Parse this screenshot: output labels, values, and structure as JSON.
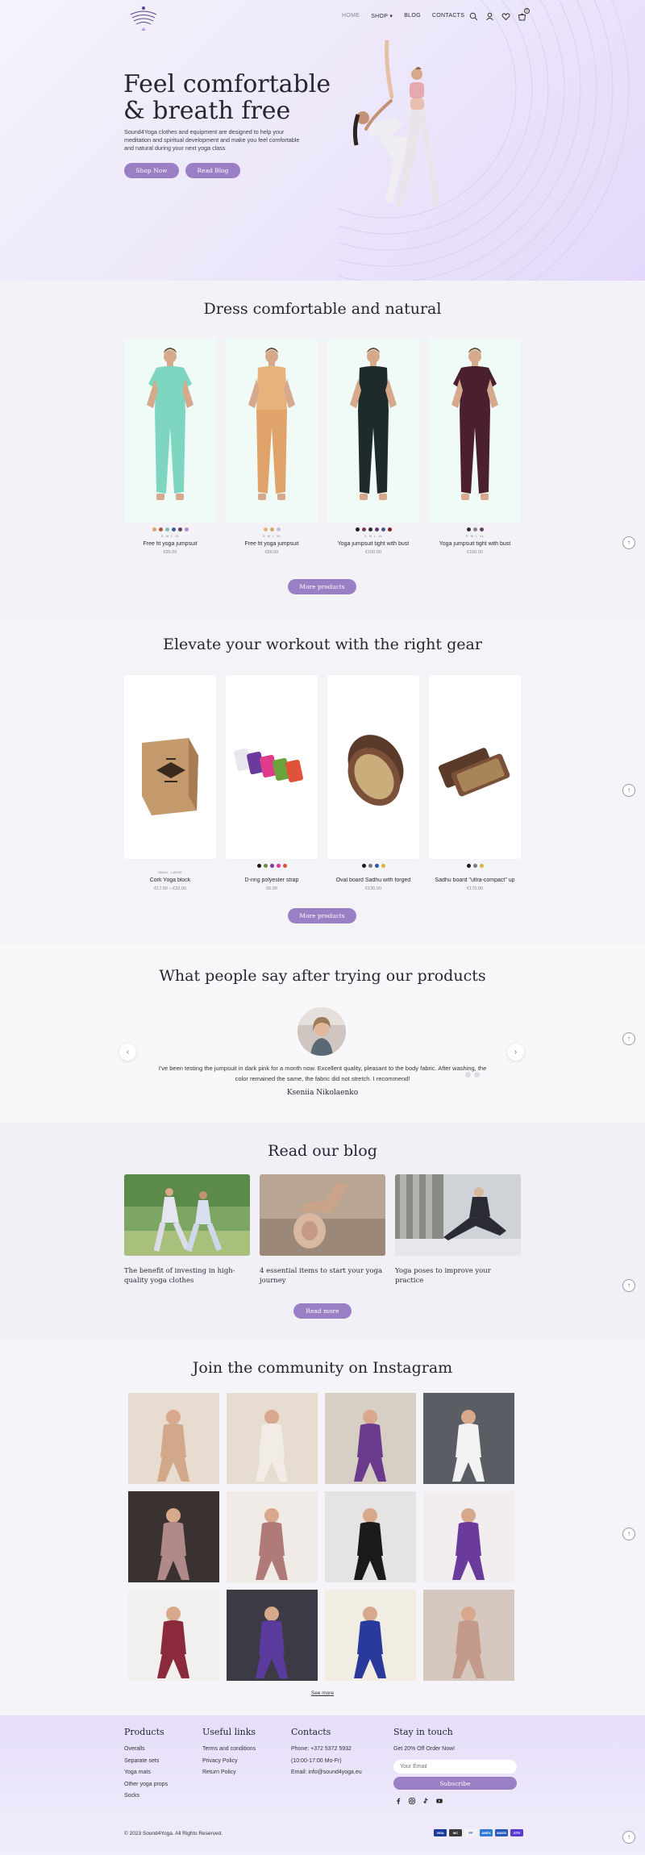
{
  "header": {
    "nav": [
      "HOME",
      "SHOP",
      "BLOG",
      "CONTACTS"
    ],
    "cart_count": "0",
    "icons": [
      "search-icon",
      "user-icon",
      "heart-icon",
      "cart-icon"
    ]
  },
  "hero": {
    "title_line1": "Feel comfortable",
    "title_line2": "& breath free",
    "text": "Sound4Yoga clothes and equipment are designed to help your meditation and spiritual development and make you feel comfortable and natural during your next yoga class",
    "btn_shop": "Shop Now",
    "btn_blog": "Read Blog"
  },
  "clothes": {
    "title": "Dress comfortable and natural",
    "products": [
      {
        "name": "Free fit yoga jumpsuit",
        "price": "€95.00",
        "swatches": [
          "#d8a46c",
          "#b25a3c",
          "#7ac3b0",
          "#3c5a9c",
          "#6a3b6b",
          "#b28ec9"
        ],
        "sizes": [
          "S",
          "M",
          "L",
          "XL"
        ]
      },
      {
        "name": "Free fit yoga jumpsuit",
        "price": "€95.00",
        "swatches": [
          "#e0b078",
          "#d8a46c",
          "#c9c0d8"
        ],
        "sizes": [
          "S",
          "M",
          "L",
          "XL"
        ]
      },
      {
        "name": "Yoga jumpsuit tight with bust",
        "price": "€100.00",
        "swatches": [
          "#1b1b1b",
          "#7a3a46",
          "#2d2d45",
          "#6a3b6b",
          "#3c5a9c",
          "#8c1c2a"
        ],
        "sizes": [
          "S",
          "M",
          "L",
          "XL"
        ]
      },
      {
        "name": "Yoga jumpsuit tight with bust",
        "price": "€100.00",
        "swatches": [
          "#3a2b3a",
          "#8a7c8c",
          "#6a3b6b"
        ],
        "sizes": [
          "S",
          "M",
          "L",
          "XL"
        ]
      }
    ],
    "more_label": "More products"
  },
  "gear": {
    "title": "Elevate your workout with the right gear",
    "products": [
      {
        "name": "Cork Yoga block",
        "price": "€17.50 – €33.00",
        "swatches": [],
        "sizes": [
          "SMALL",
          "LARGE"
        ]
      },
      {
        "name": "D-ring polyester strap",
        "price": "€6.00",
        "swatches": [
          "#1b1b1b",
          "#6a8a3c",
          "#7a3a9c",
          "#e03a8c",
          "#e0533a"
        ],
        "sizes": []
      },
      {
        "name": "Oval board Sadhu with forged",
        "price": "€130.00",
        "swatches": [
          "#1b1b1b",
          "#7a7a7a",
          "#2e5aa8",
          "#d8b43c"
        ],
        "sizes": []
      },
      {
        "name": "Sadhu board \"ultra-compact\" up",
        "price": "€170.00",
        "swatches": [
          "#1b1b1b",
          "#7a7a7a",
          "#d8b43c"
        ],
        "sizes": []
      }
    ],
    "more_label": "More products"
  },
  "testimonials": {
    "title": "What people say after trying our products",
    "quote": "I've been testing the jumpsuit in dark pink for a month now. Excellent quality, pleasant to the body fabric. After washing, the color remained the same, the fabric did not stretch. I recommend!",
    "author": "Kseniia Nikolaenko"
  },
  "blog": {
    "title": "Read our blog",
    "posts": [
      {
        "title": "The benefit of investing in high-quality yoga clothes"
      },
      {
        "title": "4 essential items to start your yoga journey"
      },
      {
        "title": "Yoga poses to improve your practice"
      }
    ],
    "more_label": "Read more"
  },
  "instagram": {
    "title": "Join the community on Instagram",
    "see_more": "See more"
  },
  "footer": {
    "products_title": "Products",
    "products": [
      "Overalls",
      "Separate sets",
      "Yoga mats",
      "Other yoga props",
      "Socks"
    ],
    "links_title": "Useful links",
    "links": [
      "Terms and conditions",
      "Privacy Policy",
      "Return Policy"
    ],
    "contacts_title": "Contacts",
    "contacts": [
      "Phone: +372 5372 5932",
      "(10:00-17:00 Mo-Fr)",
      "Email: info@sound4yoga.eu"
    ],
    "newsletter_title": "Stay in touch",
    "newsletter_text": "Get 20% Off Order Now!",
    "email_placeholder": "Your Email",
    "subscribe_label": "Subscribe",
    "copyright": "© 2023 Sound4Yoga. All Rights Reserved.",
    "payments": [
      "VISA",
      "MC",
      "PP",
      "AMEX",
      "MAES",
      "STR"
    ]
  },
  "colors": {
    "accent": "#9a7fc4",
    "hero_bg": "#ece6fa"
  }
}
